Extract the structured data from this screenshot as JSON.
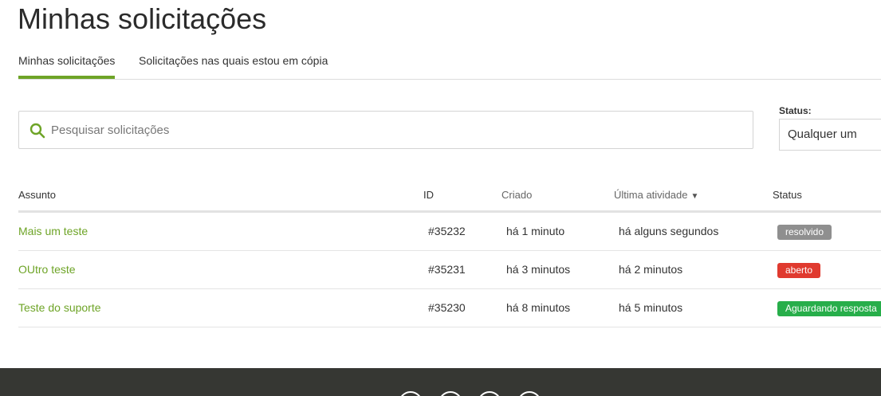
{
  "page": {
    "title": "Minhas solicitações"
  },
  "tabs": [
    {
      "label": "Minhas solicitações",
      "active": true
    },
    {
      "label": "Solicitações nas quais estou em cópia",
      "active": false
    }
  ],
  "search": {
    "placeholder": "Pesquisar solicitações",
    "value": "",
    "icon": "search-icon"
  },
  "status_filter": {
    "label": "Status:",
    "selected": "Qualquer um"
  },
  "table": {
    "headers": {
      "subject": "Assunto",
      "id": "ID",
      "created": "Criado",
      "activity": "Última atividade",
      "activity_sort": "▼",
      "status": "Status"
    },
    "rows": [
      {
        "subject": "Mais um teste",
        "id": "#35232",
        "created": "há 1 minuto",
        "activity": "há alguns segundos",
        "status": "resolvido",
        "status_color": "#8f8f8f"
      },
      {
        "subject": "OUtro teste",
        "id": "#35231",
        "created": "há 3 minutos",
        "activity": "há 2 minutos",
        "status": "aberto",
        "status_color": "#e03a2f"
      },
      {
        "subject": "Teste do suporte",
        "id": "#35230",
        "created": "há 8 minutos",
        "activity": "há 5 minutos",
        "status": "Aguardando resposta",
        "status_color": "#27ae4a"
      }
    ]
  },
  "colors": {
    "accent": "#6ea427",
    "footer": "#363733"
  },
  "footer": {
    "social_icons": [
      "facebook-icon",
      "twitter-icon",
      "instagram-icon",
      "youtube-icon"
    ]
  }
}
